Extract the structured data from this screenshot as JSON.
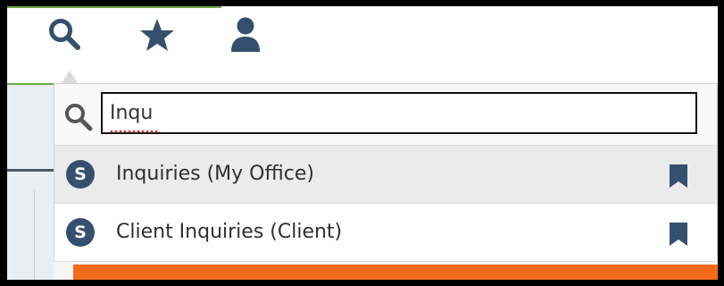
{
  "toolbar": {
    "icons": [
      "search-icon",
      "star-icon",
      "person-icon"
    ],
    "icon_color": "#34506e"
  },
  "search": {
    "query": "Inqu",
    "placeholder": ""
  },
  "results": [
    {
      "badge": "S",
      "label": "Inquiries (My Office)",
      "icon": "bookmark-icon"
    },
    {
      "badge": "S",
      "label": "Client Inquiries (Client)",
      "icon": "bookmark-icon"
    }
  ],
  "colors": {
    "accent_green": "#6aa842",
    "badge": "#34506e",
    "banner": "#f26a1b"
  }
}
